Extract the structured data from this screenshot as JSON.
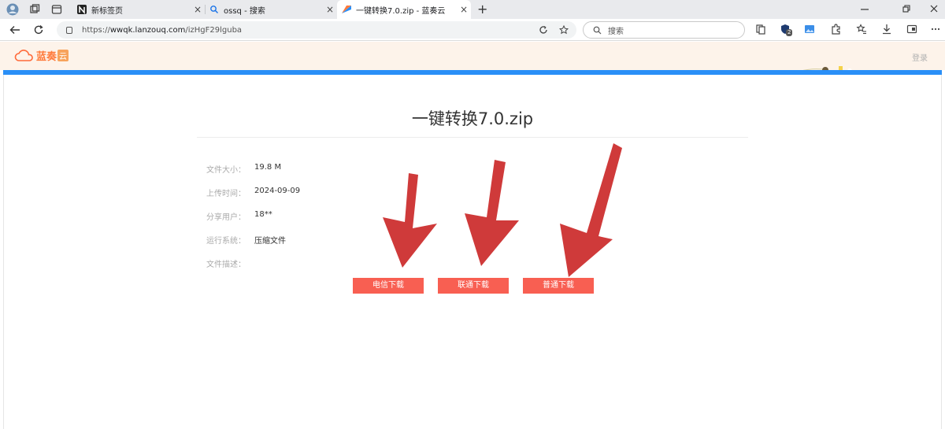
{
  "browser": {
    "tabs": [
      {
        "title": "新标签页",
        "active": false
      },
      {
        "title": "ossq - 搜索",
        "active": false
      },
      {
        "title": "一键转换7.0.zip - 蓝奏云",
        "active": true
      }
    ],
    "url_prefix": "https://",
    "url_host": "wwqk.lanzouq.com",
    "url_path": "/izHgF29lguba",
    "search_placeholder": "搜索",
    "new_tab_symbol": "+",
    "close_symbol": "×",
    "badge_count": "2"
  },
  "site": {
    "logo_text": "蓝奏",
    "logo_badge": "云",
    "login_label": "登录",
    "accent_color": "#2a8ff7",
    "button_color": "#f85f52"
  },
  "file": {
    "title": "一键转换7.0.zip",
    "info": [
      {
        "label": "文件大小：",
        "value": "19.8 M"
      },
      {
        "label": "上传时间：",
        "value": "2024-09-09"
      },
      {
        "label": "分享用户：",
        "value": "18**"
      },
      {
        "label": "运行系统：",
        "value": "压缩文件"
      },
      {
        "label": "文件描述：",
        "value": ""
      }
    ]
  },
  "downloads": [
    {
      "label": "电信下载"
    },
    {
      "label": "联通下载"
    },
    {
      "label": "普通下载"
    }
  ]
}
